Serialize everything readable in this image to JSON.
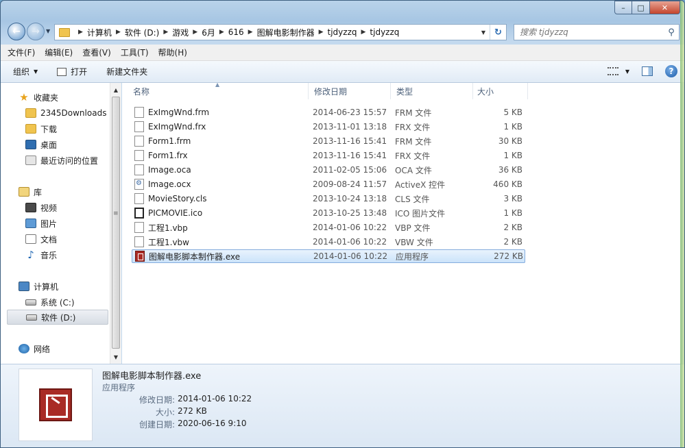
{
  "address": {
    "crumbs": [
      "计算机",
      "软件 (D:)",
      "游戏",
      "6月",
      "616",
      "图解电影制作器",
      "tjdyzzq",
      "tjdyzzq"
    ]
  },
  "search": {
    "placeholder": "搜索 tjdyzzq"
  },
  "menu": [
    "文件(F)",
    "编辑(E)",
    "查看(V)",
    "工具(T)",
    "帮助(H)"
  ],
  "toolbar": {
    "organize": "组织",
    "open": "打开",
    "new_folder": "新建文件夹"
  },
  "nav": {
    "favorites": "收藏夹",
    "fav_items": [
      "2345Downloads",
      "下载",
      "桌面",
      "最近访问的位置"
    ],
    "libraries": "库",
    "lib_items": [
      "视频",
      "图片",
      "文档",
      "音乐"
    ],
    "computer": "计算机",
    "drives": [
      "系统 (C:)",
      "软件 (D:)"
    ],
    "network": "网络"
  },
  "columns": {
    "name": "名称",
    "date": "修改日期",
    "type": "类型",
    "size": "大小"
  },
  "files": [
    {
      "name": "ExImgWnd.frm",
      "date": "2014-06-23 15:57",
      "type": "FRM 文件",
      "size": "5 KB"
    },
    {
      "name": "ExImgWnd.frx",
      "date": "2013-11-01 13:18",
      "type": "FRX 文件",
      "size": "1 KB"
    },
    {
      "name": "Form1.frm",
      "date": "2013-11-16 15:41",
      "type": "FRM 文件",
      "size": "30 KB"
    },
    {
      "name": "Form1.frx",
      "date": "2013-11-16 15:41",
      "type": "FRX 文件",
      "size": "1 KB"
    },
    {
      "name": "Image.oca",
      "date": "2011-02-05 15:06",
      "type": "OCA 文件",
      "size": "36 KB"
    },
    {
      "name": "Image.ocx",
      "date": "2009-08-24 11:57",
      "type": "ActiveX 控件",
      "size": "460 KB"
    },
    {
      "name": "MovieStory.cls",
      "date": "2013-10-24 13:18",
      "type": "CLS 文件",
      "size": "3 KB"
    },
    {
      "name": "PICMOVIE.ico",
      "date": "2013-10-25 13:48",
      "type": "ICO 图片文件",
      "size": "1 KB"
    },
    {
      "name": "工程1.vbp",
      "date": "2014-01-06 10:22",
      "type": "VBP 文件",
      "size": "2 KB"
    },
    {
      "name": "工程1.vbw",
      "date": "2014-01-06 10:22",
      "type": "VBW 文件",
      "size": "2 KB"
    },
    {
      "name": "图解电影脚本制作器.exe",
      "date": "2014-01-06 10:22",
      "type": "应用程序",
      "size": "272 KB"
    }
  ],
  "details": {
    "name": "图解电影脚本制作器.exe",
    "type": "应用程序",
    "modified_label": "修改日期:",
    "modified": "2014-01-06 10:22",
    "size_label": "大小:",
    "size": "272 KB",
    "created_label": "创建日期:",
    "created": "2020-06-16 9:10"
  }
}
